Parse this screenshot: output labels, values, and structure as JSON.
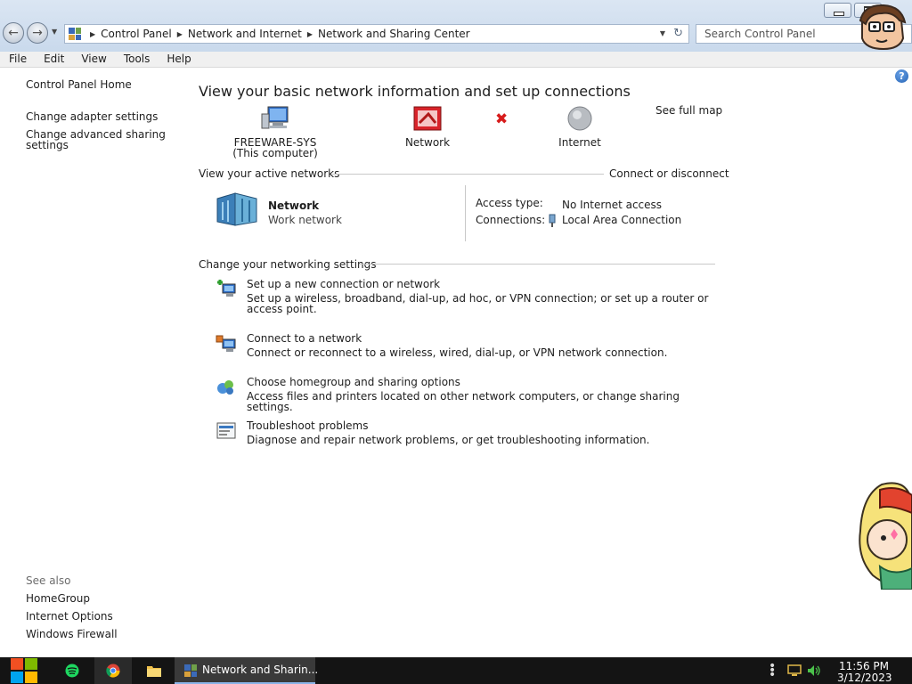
{
  "window": {
    "breadcrumb": [
      "Control Panel",
      "Network and Internet",
      "Network and Sharing Center"
    ],
    "search_placeholder": "Search Control Panel"
  },
  "menu": [
    "File",
    "Edit",
    "View",
    "Tools",
    "Help"
  ],
  "left_nav": {
    "home": "Control Panel Home",
    "links": [
      "Change adapter settings",
      "Change advanced sharing settings"
    ],
    "see_also_label": "See also",
    "see_also": [
      "HomeGroup",
      "Internet Options",
      "Windows Firewall"
    ]
  },
  "main": {
    "heading": "View your basic network information and set up connections",
    "see_full_map": "See full map",
    "map": {
      "computer_name": "FREEWARE-SYS",
      "computer_sub": "(This computer)",
      "network": "Network",
      "internet": "Internet"
    },
    "active_networks": {
      "title": "View your active networks",
      "action": "Connect or disconnect",
      "network_name": "Network",
      "network_type": "Work network",
      "access_type_label": "Access type:",
      "access_type_value": "No Internet access",
      "connections_label": "Connections:",
      "connections_value": "Local Area Connection"
    },
    "change_settings": {
      "title": "Change your networking settings",
      "tasks": [
        {
          "title": "Set up a new connection or network",
          "desc": "Set up a wireless, broadband, dial-up, ad hoc, or VPN connection; or set up a router or access point."
        },
        {
          "title": "Connect to a network",
          "desc": "Connect or reconnect to a wireless, wired, dial-up, or VPN network connection."
        },
        {
          "title": "Choose homegroup and sharing options",
          "desc": "Access files and printers located on other network computers, or change sharing settings."
        },
        {
          "title": "Troubleshoot problems",
          "desc": "Diagnose and repair network problems, or get troubleshooting information."
        }
      ]
    }
  },
  "taskbar": {
    "window_label": "Network and Sharin...",
    "time": "11:56 PM",
    "date": "3/12/2023"
  },
  "icons": {
    "back": "back-arrow-icon",
    "forward": "forward-arrow-icon",
    "refresh": "refresh-icon",
    "help": "help-icon",
    "start": "windows-logo-icon",
    "accent": "#2563b5"
  }
}
